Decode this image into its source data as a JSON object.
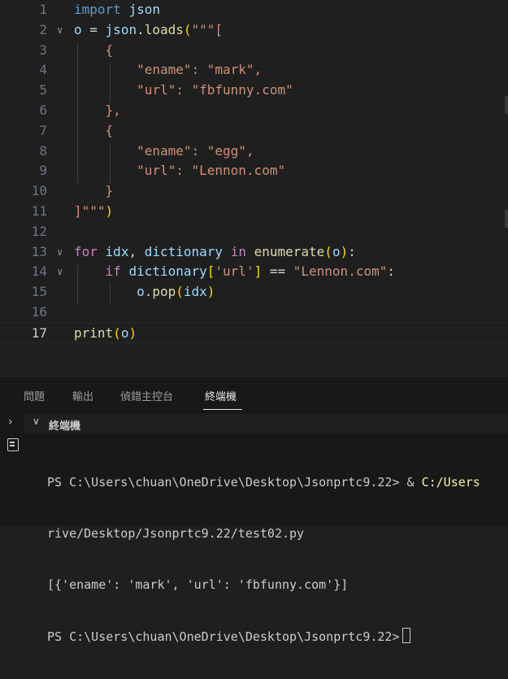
{
  "editor": {
    "active_line": "17",
    "lines": [
      {
        "num": "1",
        "tokens": [
          [
            "kw",
            "import"
          ],
          [
            "txt",
            " "
          ],
          [
            "var",
            "json"
          ]
        ]
      },
      {
        "num": "2",
        "fold": "∨",
        "tokens": [
          [
            "var",
            "o"
          ],
          [
            "txt",
            " = "
          ],
          [
            "var",
            "json"
          ],
          [
            "txt",
            "."
          ],
          [
            "fn",
            "loads"
          ],
          [
            "br1",
            "("
          ],
          [
            "str",
            "\"\"\"["
          ]
        ]
      },
      {
        "num": "3",
        "tokens": [
          [
            "str",
            "    {"
          ]
        ]
      },
      {
        "num": "4",
        "tokens": [
          [
            "str",
            "        \"ename\": \"mark\","
          ]
        ]
      },
      {
        "num": "5",
        "tokens": [
          [
            "str",
            "        \"url\": \"fbfunny.com\""
          ]
        ]
      },
      {
        "num": "6",
        "tokens": [
          [
            "str",
            "    },"
          ]
        ]
      },
      {
        "num": "7",
        "tokens": [
          [
            "str",
            "    {"
          ]
        ]
      },
      {
        "num": "8",
        "tokens": [
          [
            "str",
            "        \"ename\": \"egg\","
          ]
        ]
      },
      {
        "num": "9",
        "tokens": [
          [
            "str",
            "        \"url\": \"Lennon.com\""
          ]
        ]
      },
      {
        "num": "10",
        "tokens": [
          [
            "str",
            "    }"
          ]
        ]
      },
      {
        "num": "11",
        "tokens": [
          [
            "str",
            "]\"\"\""
          ],
          [
            "br1",
            ")"
          ]
        ]
      },
      {
        "num": "12",
        "tokens": []
      },
      {
        "num": "13",
        "fold": "∨",
        "tokens": [
          [
            "ctl",
            "for"
          ],
          [
            "txt",
            " "
          ],
          [
            "var",
            "idx"
          ],
          [
            "txt",
            ", "
          ],
          [
            "var",
            "dictionary"
          ],
          [
            "txt",
            " "
          ],
          [
            "ctl",
            "in"
          ],
          [
            "txt",
            " "
          ],
          [
            "fn",
            "enumerate"
          ],
          [
            "br1",
            "("
          ],
          [
            "var",
            "o"
          ],
          [
            "br1",
            ")"
          ],
          [
            "txt",
            ":"
          ]
        ]
      },
      {
        "num": "14",
        "fold": "∨",
        "tokens": [
          [
            "txt",
            "    "
          ],
          [
            "ctl",
            "if"
          ],
          [
            "txt",
            " "
          ],
          [
            "var",
            "dictionary"
          ],
          [
            "br1",
            "["
          ],
          [
            "str",
            "'url'"
          ],
          [
            "br1",
            "]"
          ],
          [
            "txt",
            " == "
          ],
          [
            "str",
            "\"Lennon.com\""
          ],
          [
            "txt",
            ":"
          ]
        ]
      },
      {
        "num": "15",
        "tokens": [
          [
            "txt",
            "        "
          ],
          [
            "var",
            "o"
          ],
          [
            "txt",
            "."
          ],
          [
            "fn",
            "pop"
          ],
          [
            "br1",
            "("
          ],
          [
            "var",
            "idx"
          ],
          [
            "br1",
            ")"
          ]
        ]
      },
      {
        "num": "16",
        "tokens": []
      },
      {
        "num": "17",
        "tokens": [
          [
            "fn",
            "print"
          ],
          [
            "br1",
            "("
          ],
          [
            "var",
            "o"
          ],
          [
            "br1",
            ")"
          ]
        ]
      }
    ]
  },
  "panel": {
    "tabs": [
      {
        "label": "問題",
        "active": false
      },
      {
        "label": "輸出",
        "active": false
      },
      {
        "label": "偵錯主控台",
        "active": false
      },
      {
        "label": "終端機",
        "active": true
      }
    ],
    "terminal_title": "終端機",
    "terminal": {
      "line1_prompt": "PS C:\\Users\\chuan\\OneDrive\\Desktop\\Jsonprtc9.22> & ",
      "line1_cmd": "C:/Users",
      "line2": "rive/Desktop/Jsonprtc9.22/test02.py",
      "line3": "[{'ename': 'mark', 'url': 'fbfunny.com'}]",
      "line4_prompt": "PS C:\\Users\\chuan\\OneDrive\\Desktop\\Jsonprtc9.22>"
    }
  },
  "icons": {
    "fold_open": "chevron-down-icon",
    "side_expand": "chevron-right-icon",
    "terminal": "terminal-icon"
  }
}
